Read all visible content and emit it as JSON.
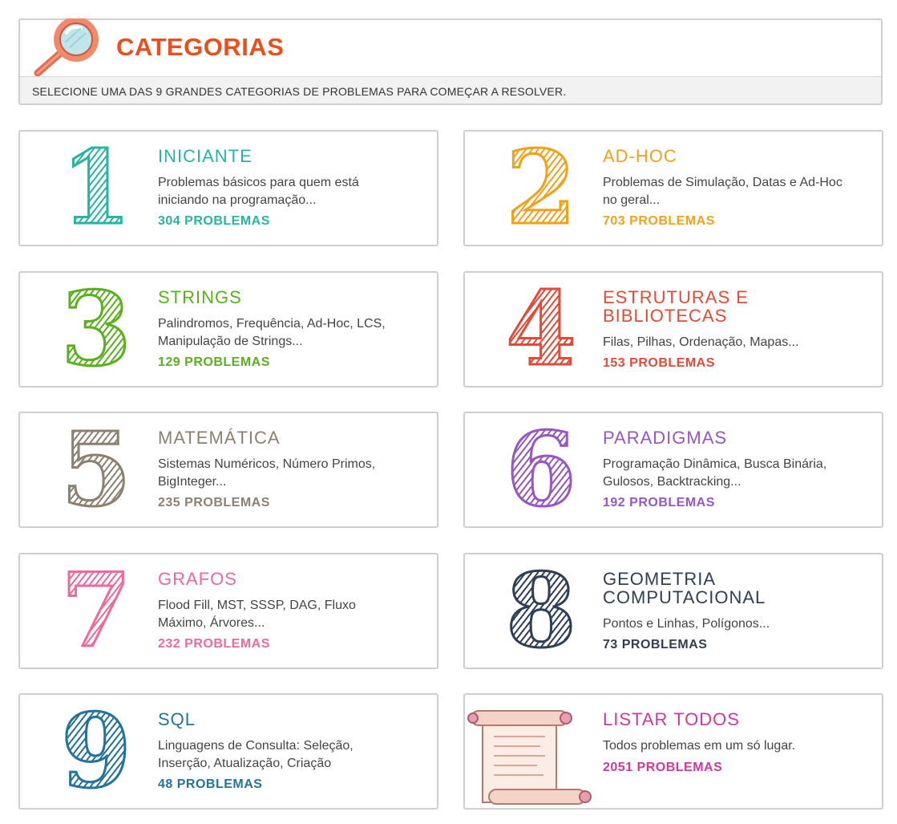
{
  "header": {
    "title": "CATEGORIAS",
    "subtitle": "SELECIONE UMA DAS 9 GRANDES CATEGORIAS DE PROBLEMAS PARA COMEÇAR A RESOLVER.",
    "icon": "magnifier-icon"
  },
  "categories": [
    {
      "number": "1",
      "title": "INICIANTE",
      "description": "Problemas básicos para quem está iniciando na programação...",
      "count": "304 PROBLEMAS",
      "color": "#26b5a0"
    },
    {
      "number": "2",
      "title": "AD-HOC",
      "description": "Problemas de Simulação, Datas e Ad-Hoc no geral...",
      "count": "703 PROBLEMAS",
      "color": "#f2a11b"
    },
    {
      "number": "3",
      "title": "STRINGS",
      "description": "Palindromos, Frequência, Ad-Hoc, LCS, Manipulação de Strings...",
      "count": "129 PROBLEMAS",
      "color": "#5bb01e"
    },
    {
      "number": "4",
      "title": "ESTRUTURAS E BIBLIOTECAS",
      "description": "Filas, Pilhas, Ordenação, Mapas...",
      "count": "153 PROBLEMAS",
      "color": "#e14b38"
    },
    {
      "number": "5",
      "title": "MATEMÁTICA",
      "description": "Sistemas Numéricos, Número Primos, BigInteger...",
      "count": "235 PROBLEMAS",
      "color": "#8e8070"
    },
    {
      "number": "6",
      "title": "PARADIGMAS",
      "description": "Programação Dinâmica, Busca Binária, Gulosos, Backtracking...",
      "count": "192 PROBLEMAS",
      "color": "#9757c2"
    },
    {
      "number": "7",
      "title": "GRAFOS",
      "description": "Flood Fill, MST, SSSP, DAG, Fluxo Máximo, Árvores...",
      "count": "232 PROBLEMAS",
      "color": "#ee6a9c"
    },
    {
      "number": "8",
      "title": "GEOMETRIA COMPUTACIONAL",
      "description": "Pontos e Linhas, Polígonos...",
      "count": "73 PROBLEMAS",
      "color": "#2f3f55"
    },
    {
      "number": "9",
      "title": "SQL",
      "description": "Linguagens de Consulta: Seleção, Inserção, Atualização, Criação",
      "count": "48 PROBLEMAS",
      "color": "#23739b"
    },
    {
      "number": "",
      "title": "LISTAR TODOS",
      "description": "Todos problemas em um só lugar.",
      "count": "2051 PROBLEMAS",
      "color": "#d2379d",
      "icon": "scroll-icon"
    }
  ]
}
